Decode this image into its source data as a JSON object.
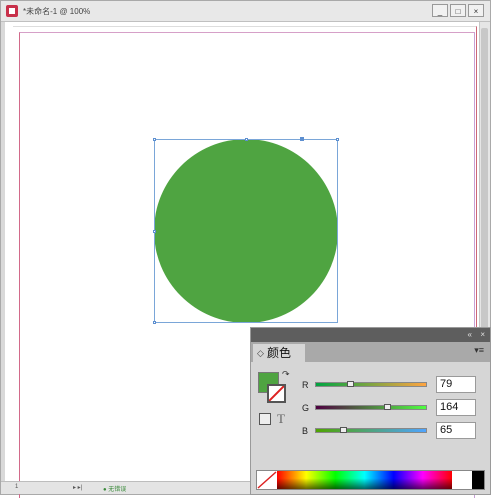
{
  "window": {
    "title": "*未命名-1 @ 100%",
    "controls": [
      "_",
      "□",
      "×"
    ]
  },
  "statusbar": {
    "page": "1",
    "nav": "▸ ▸|",
    "preflight": "● 无错误"
  },
  "color_panel": {
    "collapse_label": "«",
    "close_label": "×",
    "tab_icon": "◇",
    "tab_label": "颜色",
    "menu_label": "▾≡",
    "swap_icon": "↷",
    "text_icon": "T",
    "fill_color": "#4fa441",
    "channels": [
      {
        "label": "R",
        "value": "79",
        "fraction": 0.31,
        "gradient": [
          "#00a441",
          "#ffa441"
        ]
      },
      {
        "label": "G",
        "value": "164",
        "fraction": 0.64,
        "gradient": [
          "#4f0041",
          "#4fff41"
        ]
      },
      {
        "label": "B",
        "value": "65",
        "fraction": 0.25,
        "gradient": [
          "#4fa400",
          "#4fa4ff"
        ]
      }
    ]
  },
  "object": {
    "shape": "ellipse",
    "fill_color": "#4fa441"
  }
}
